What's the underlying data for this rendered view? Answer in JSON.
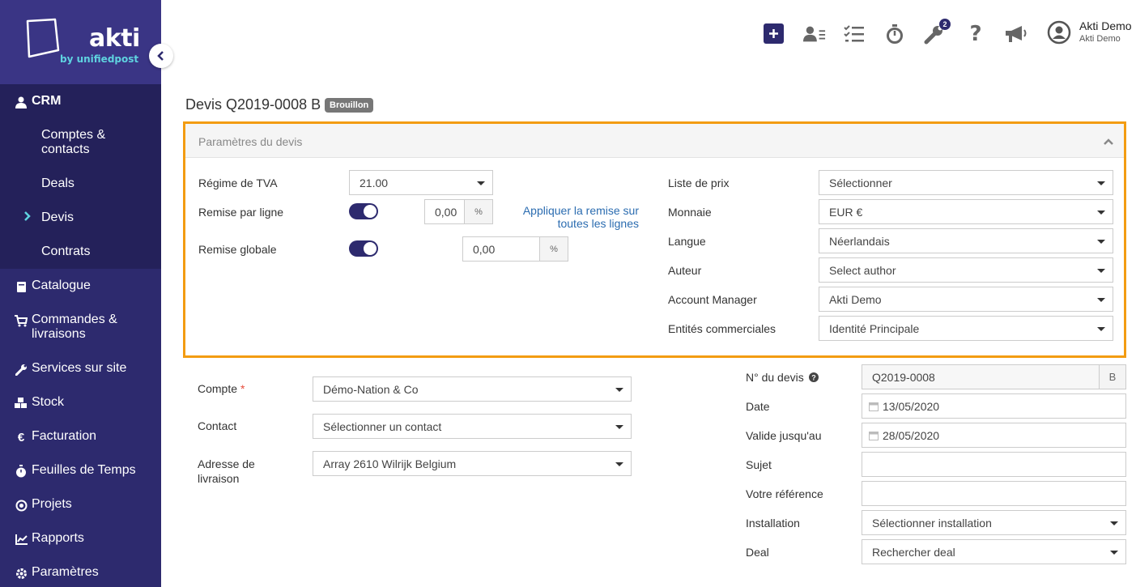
{
  "sidebar": {
    "logo_text": "akti",
    "logo_sub": "by unifiedpost",
    "crm": "CRM",
    "crm_items": [
      "Comptes & contacts",
      "Deals",
      "Devis",
      "Contrats"
    ],
    "nav": [
      {
        "label": "Catalogue",
        "icon": "book-icon"
      },
      {
        "label": "Commandes & livraisons",
        "icon": "cart-icon"
      },
      {
        "label": "Services sur site",
        "icon": "wrench-icon"
      },
      {
        "label": "Stock",
        "icon": "cubes-icon"
      },
      {
        "label": "Facturation",
        "icon": "euro-icon"
      },
      {
        "label": "Feuilles de Temps",
        "icon": "stopwatch-icon"
      },
      {
        "label": "Projets",
        "icon": "bullseye-icon"
      },
      {
        "label": "Rapports",
        "icon": "chart-icon"
      },
      {
        "label": "Paramètres",
        "icon": "gear-icon"
      }
    ],
    "accent": "#5fd3e0",
    "bg": "#2d2a6e"
  },
  "topbar": {
    "badge": "2",
    "user_name": "Akti Demo",
    "user_company": "Akti Demo"
  },
  "page": {
    "title": "Devis Q2019-0008 B",
    "status": "Brouillon"
  },
  "panel": {
    "title": "Paramètres du devis",
    "highlight_color": "#f39c12",
    "vat_label": "Régime de TVA",
    "vat_value": "21.00",
    "line_discount_label": "Remise par ligne",
    "line_discount_value": "0,00",
    "percent": "%",
    "apply_link": "Appliquer la remise sur toutes les lignes",
    "global_discount_label": "Remise globale",
    "global_discount_value": "0,00",
    "price_list_label": "Liste de prix",
    "price_list_value": "Sélectionner",
    "currency_label": "Monnaie",
    "currency_value": "EUR €",
    "language_label": "Langue",
    "language_value": "Néerlandais",
    "author_label": "Auteur",
    "author_value": "Select author",
    "manager_label": "Account Manager",
    "manager_value": "Akti Demo",
    "entities_label": "Entités commerciales",
    "entities_value": "Identité Principale"
  },
  "form": {
    "account_label": "Compte",
    "required_mark": "*",
    "account_value": "Démo-Nation & Co",
    "contact_label": "Contact",
    "contact_value": "Sélectionner un contact",
    "address_label": "Adresse de livraison",
    "address_value": "Array 2610 Wilrijk Belgium",
    "quote_no_label": "N° du devis",
    "quote_no_value": "Q2019-0008",
    "quote_suffix": "B",
    "date_label": "Date",
    "date_value": "13/05/2020",
    "valid_label": "Valide jusqu'au",
    "valid_value": "28/05/2020",
    "subject_label": "Sujet",
    "subject_value": "",
    "reference_label": "Votre référence",
    "reference_value": "",
    "installation_label": "Installation",
    "installation_value": "Sélectionner installation",
    "deal_label": "Deal",
    "deal_value": "Rechercher deal"
  }
}
